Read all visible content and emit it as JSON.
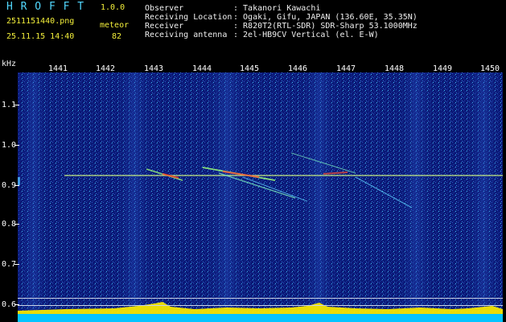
{
  "app": {
    "name": "H R O F F T",
    "version": "1.0.0",
    "filename": "2511151440.png",
    "timestamp": "25.11.15 14:40",
    "mode_label": "meteor",
    "count": "82"
  },
  "info": {
    "labels": [
      "Observer",
      "Receiving Location",
      "Receiver",
      "Receiving antenna"
    ],
    "values": [
      ": Takanori Kawachi",
      ": Ogaki, Gifu, JAPAN (136.60E, 35.35N)",
      ": R820T2(RTL-SDR) SDR-Sharp 53.1000MHz",
      ": 2el-HB9CV Vertical (el. E-W)"
    ]
  },
  "axis": {
    "y_unit": "kHz",
    "x_ticks": [
      "1441",
      "1442",
      "1443",
      "1444",
      "1445",
      "1446",
      "1447",
      "1448",
      "1449",
      "1450"
    ],
    "y_ticks": [
      "1.1",
      "1.0",
      "0.9",
      "0.8",
      "0.7",
      "0.6"
    ]
  },
  "colors": {
    "background": "#0a1870",
    "text_cyan": "#52d8ff",
    "text_yellow": "#f2ee3a",
    "signal": "#d8ff80",
    "activity": "#f6e600"
  }
}
